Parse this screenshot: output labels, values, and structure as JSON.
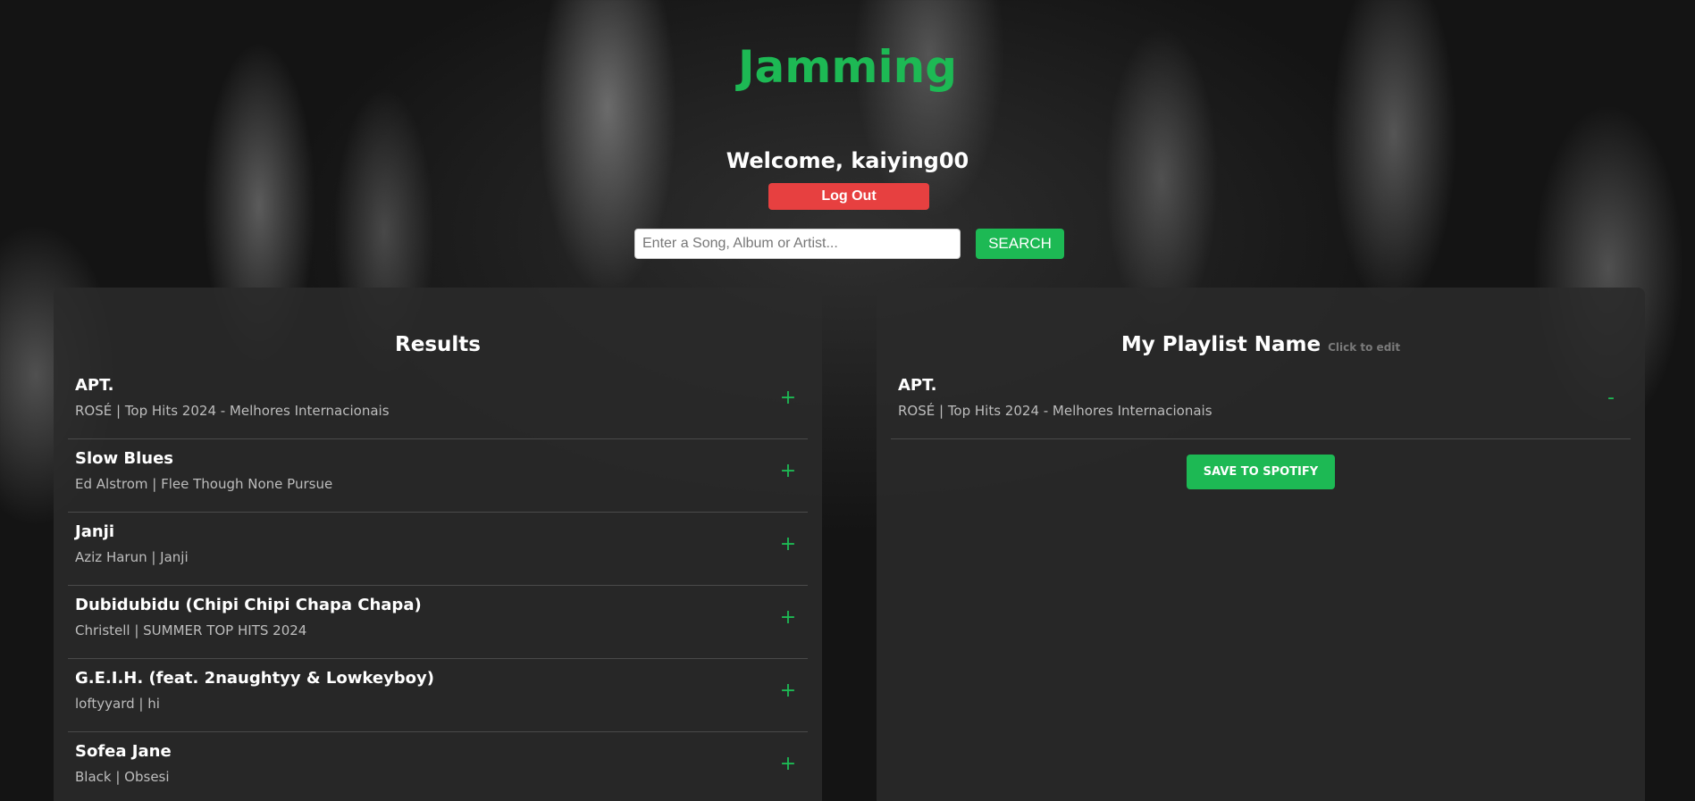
{
  "app": {
    "title": "Jamming"
  },
  "user": {
    "welcome": "Welcome, kaiying00",
    "logout_label": "Log Out"
  },
  "search": {
    "placeholder": "Enter a Song, Album or Artist...",
    "value": "",
    "button_label": "SEARCH"
  },
  "results": {
    "heading": "Results",
    "action_symbol": "+",
    "tracks": [
      {
        "name": "APT.",
        "meta": "ROSÉ | Top Hits 2024 - Melhores Internacionais"
      },
      {
        "name": "Slow Blues",
        "meta": "Ed Alstrom | Flee Though None Pursue"
      },
      {
        "name": "Janji",
        "meta": "Aziz Harun | Janji"
      },
      {
        "name": "Dubidubidu (Chipi Chipi Chapa Chapa)",
        "meta": "Christell | SUMMER TOP HITS 2024"
      },
      {
        "name": "G.E.I.H. (feat. 2naughtyy & Lowkeyboy)",
        "meta": "loftyyard | hi"
      },
      {
        "name": "Sofea Jane",
        "meta": "Black | Obsesi"
      }
    ]
  },
  "playlist": {
    "name": "My Playlist Name",
    "edit_hint": "Click to edit",
    "action_symbol": "-",
    "tracks": [
      {
        "name": "APT.",
        "meta": "ROSÉ | Top Hits 2024 - Melhores Internacionais"
      }
    ],
    "save_label": "SAVE TO SPOTIFY"
  },
  "colors": {
    "accent": "#1db954",
    "danger": "#e74040",
    "panel": "#2a2a2a",
    "background": "#141414"
  },
  "icons": {
    "add": "plus-icon",
    "remove": "minus-icon"
  }
}
